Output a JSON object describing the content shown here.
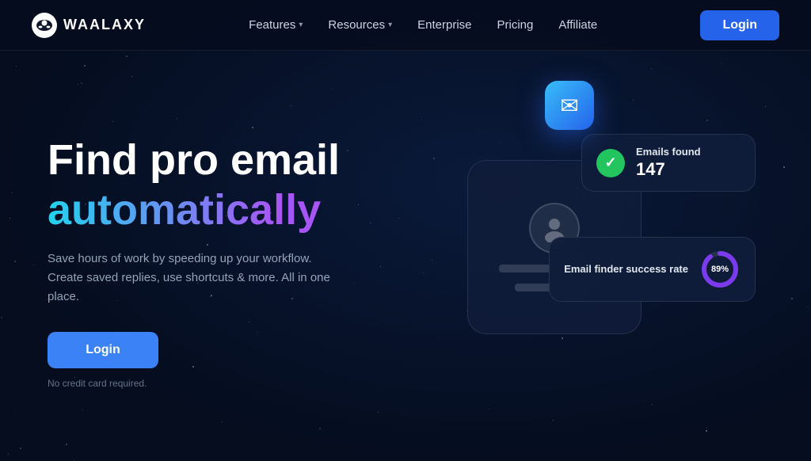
{
  "brand": {
    "name": "WAALAXY",
    "logo_alt": "waalaxy alien logo"
  },
  "nav": {
    "links": [
      {
        "label": "Features",
        "has_dropdown": true
      },
      {
        "label": "Resources",
        "has_dropdown": true
      },
      {
        "label": "Enterprise",
        "has_dropdown": false
      },
      {
        "label": "Pricing",
        "has_dropdown": false
      },
      {
        "label": "Affiliate",
        "has_dropdown": false
      }
    ],
    "login_label": "Login"
  },
  "hero": {
    "title_line1": "Find pro email",
    "title_line2": "automatically",
    "subtitle": "Save hours of work by speeding up your workflow. Create saved replies, use shortcuts & more. All in one place.",
    "cta_label": "Login",
    "no_credit": "No credit card required."
  },
  "stats": {
    "emails_found_label": "Emails found",
    "emails_found_value": "147",
    "rate_label": "Email finder success rate",
    "rate_value": "89%",
    "rate_number": 89
  },
  "colors": {
    "bg": "#050d1f",
    "accent_blue": "#2563eb",
    "accent_cyan": "#22d3ee",
    "accent_purple": "#a855f7",
    "green": "#22c55e"
  }
}
